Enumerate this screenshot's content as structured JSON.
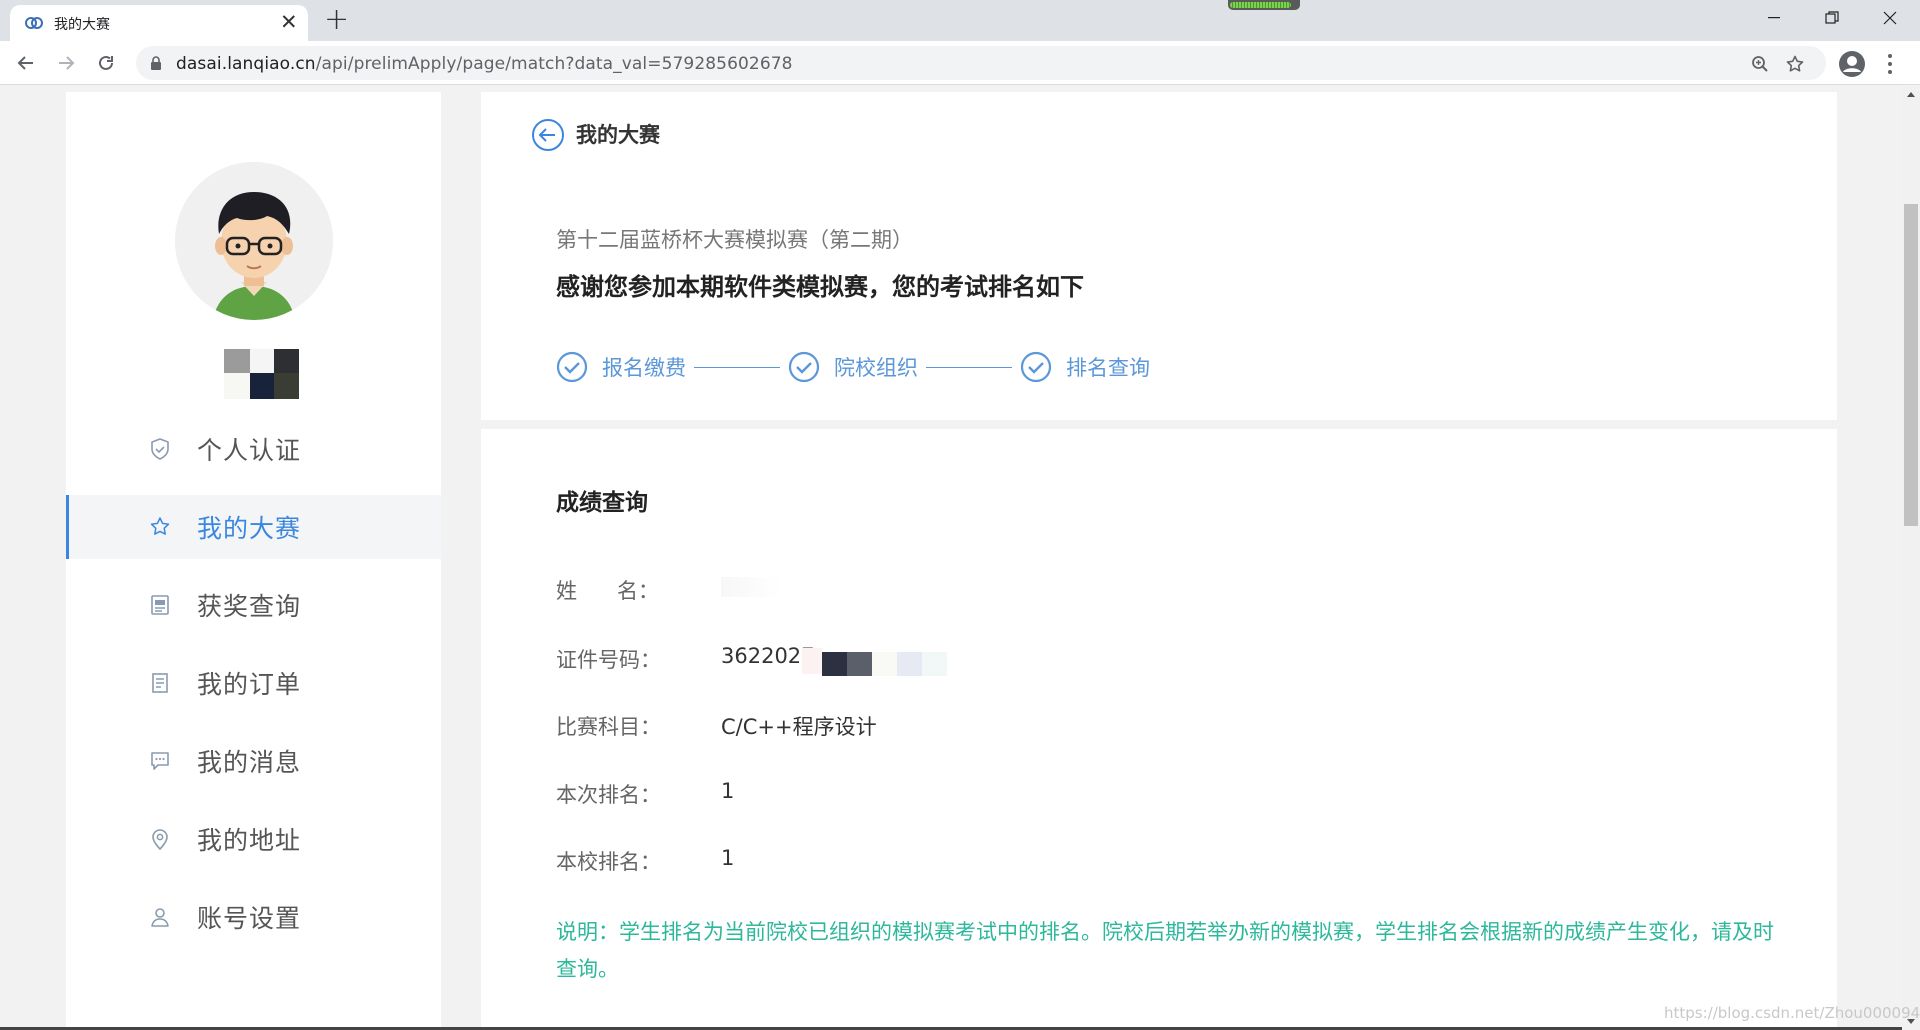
{
  "browser": {
    "tab_title": "我的大赛",
    "url_host": "dasai.lanqiao.cn",
    "url_path": "/api/prelimApply/page/match?data_val=579285602678",
    "loading_progress": 0.9
  },
  "sidebar": {
    "items": [
      {
        "label": "个人认证",
        "icon": "shield-icon"
      },
      {
        "label": "我的大赛",
        "icon": "star-icon",
        "active": true
      },
      {
        "label": "获奖查询",
        "icon": "award-doc-icon"
      },
      {
        "label": "我的订单",
        "icon": "order-icon"
      },
      {
        "label": "我的消息",
        "icon": "message-icon"
      },
      {
        "label": "我的地址",
        "icon": "location-icon"
      },
      {
        "label": "账号设置",
        "icon": "user-icon"
      }
    ]
  },
  "header": {
    "back_title": "我的大赛",
    "match_name": "第十二届蓝桥杯大赛模拟赛（第二期）",
    "thanks": "感谢您参加本期软件类模拟赛，您的考试排名如下",
    "steps": [
      "报名缴费",
      "院校组织",
      "排名查询"
    ]
  },
  "result": {
    "title": "成绩查询",
    "rows": [
      {
        "label": "姓      名：",
        "value": ""
      },
      {
        "label": "证件号码：",
        "value": "3622027"
      },
      {
        "label": "比赛科目：",
        "value": "C/C++程序设计"
      },
      {
        "label": "本次排名：",
        "value": "1"
      },
      {
        "label": "本校排名：",
        "value": "1"
      }
    ],
    "note": "说明：学生排名为当前院校已组织的模拟赛考试中的排名。院校后期若举办新的模拟赛，学生排名会根据新的成绩产生变化，请及时查询。"
  },
  "watermark": "https://blog.csdn.net/Zhou000094?",
  "colors": {
    "accent": "#3b87e0",
    "step": "#5c97d8",
    "note": "#2eb89b"
  }
}
